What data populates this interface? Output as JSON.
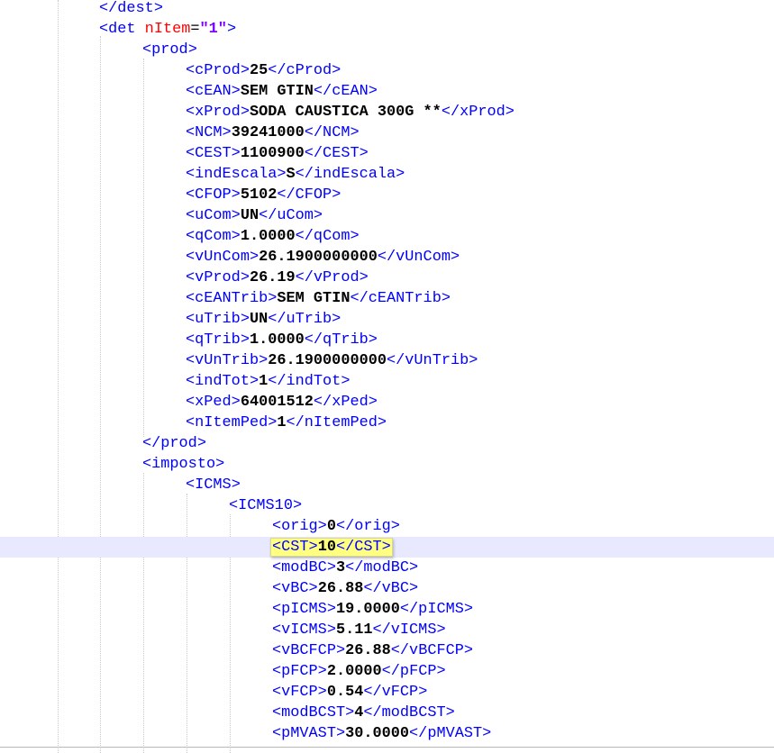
{
  "editor": {
    "current_line_index": 26,
    "lines": [
      {
        "close": "dest"
      },
      {
        "open": "det",
        "attr_name": "nItem",
        "attr_value": "\"1\""
      },
      {
        "open": "prod"
      },
      {
        "tag": "cProd",
        "value": "25"
      },
      {
        "tag": "cEAN",
        "value": "SEM GTIN"
      },
      {
        "tag": "xProd",
        "value": "SODA CAUSTICA 300G **"
      },
      {
        "tag": "NCM",
        "value": "39241000"
      },
      {
        "tag": "CEST",
        "value": "1100900"
      },
      {
        "tag": "indEscala",
        "value": "S"
      },
      {
        "tag": "CFOP",
        "value": "5102"
      },
      {
        "tag": "uCom",
        "value": "UN"
      },
      {
        "tag": "qCom",
        "value": "1.0000"
      },
      {
        "tag": "vUnCom",
        "value": "26.1900000000"
      },
      {
        "tag": "vProd",
        "value": "26.19"
      },
      {
        "tag": "cEANTrib",
        "value": "SEM GTIN"
      },
      {
        "tag": "uTrib",
        "value": "UN"
      },
      {
        "tag": "qTrib",
        "value": "1.0000"
      },
      {
        "tag": "vUnTrib",
        "value": "26.1900000000"
      },
      {
        "tag": "indTot",
        "value": "1"
      },
      {
        "tag": "xPed",
        "value": "64001512"
      },
      {
        "tag": "nItemPed",
        "value": "1"
      },
      {
        "close": "prod"
      },
      {
        "open": "imposto"
      },
      {
        "open": "ICMS"
      },
      {
        "open": "ICMS10"
      },
      {
        "tag": "orig",
        "value": "0"
      },
      {
        "tag": "CST",
        "value": "10"
      },
      {
        "tag": "modBC",
        "value": "3"
      },
      {
        "tag": "vBC",
        "value": "26.88"
      },
      {
        "tag": "pICMS",
        "value": "19.0000"
      },
      {
        "tag": "vICMS",
        "value": "5.11"
      },
      {
        "tag": "vBCFCP",
        "value": "26.88"
      },
      {
        "tag": "pFCP",
        "value": "2.0000"
      },
      {
        "tag": "vFCP",
        "value": "0.54"
      },
      {
        "tag": "modBCST",
        "value": "4"
      },
      {
        "tag": "pMVAST",
        "value": "30.0000"
      }
    ]
  }
}
